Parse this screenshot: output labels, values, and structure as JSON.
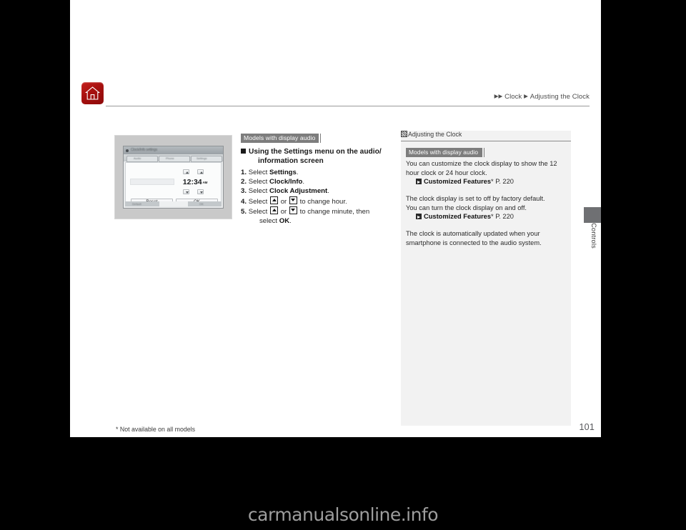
{
  "header": {
    "home_icon": "home-icon",
    "breadcrumb": {
      "arrow1": "▶",
      "arrow2": "▶",
      "item1": "Clock",
      "arrow3": "▶",
      "item2": "Adjusting the Clock"
    }
  },
  "figure": {
    "titlebar_text": "Clock/Info settings",
    "tabs_blur": [
      "Audio",
      "Phone",
      "Settings"
    ],
    "clock": {
      "hour": "12",
      "separator": ":",
      "minute": "34",
      "meridiem": "AM"
    },
    "buttons": {
      "reset": "Reset",
      "ok": "OK"
    },
    "footer_left": "Default",
    "footer_right": "OK"
  },
  "instructions": {
    "model_banner": "Models with display audio",
    "heading_line1": "Using the Settings menu on the audio/",
    "heading_line2": "information screen",
    "steps": [
      {
        "num": "1.",
        "pre": "Select ",
        "bold": "Settings",
        "post": "."
      },
      {
        "num": "2.",
        "pre": "Select ",
        "bold": "Clock/Info",
        "post": "."
      },
      {
        "num": "3.",
        "pre": "Select ",
        "bold": "Clock Adjustment",
        "post": "."
      },
      {
        "num": "4.",
        "pre": "Select ",
        "mid": " or ",
        "post": " to change hour."
      },
      {
        "num": "5.",
        "pre": "Select ",
        "mid": " or ",
        "post": " to change minute, then",
        "cont_pre": "select ",
        "cont_bold": "OK",
        "cont_post": "."
      }
    ]
  },
  "sidebar": {
    "title": "Adjusting the Clock",
    "banner": "Models with display audio",
    "para1_line1": "You can customize the clock display to show the 12",
    "para1_line2": "hour clock or 24 hour clock.",
    "ref1_label": "Customized Features",
    "ref1_asterisk": "*",
    "ref1_page": " P. 220",
    "para2_line1": "The clock display is set to off by factory default.",
    "para2_line2": "You can turn the clock display on and off.",
    "ref2_label": "Customized Features",
    "ref2_asterisk": "*",
    "ref2_page": " P. 220",
    "para3_line1": "The clock is automatically updated when your",
    "para3_line2": "smartphone is connected to the audio system."
  },
  "side_tab": {
    "label": "Controls"
  },
  "footer": {
    "footnote": "* Not available on all models",
    "page_number": "101"
  },
  "watermark": "carmanualsonline.info",
  "colors": {
    "home_red": "#a7100f",
    "banner_gray": "#7d7d7d",
    "sidebar_bg": "#f2f2f2",
    "tab_gray": "#6f7073",
    "figure_bg": "#c9c9c9"
  }
}
